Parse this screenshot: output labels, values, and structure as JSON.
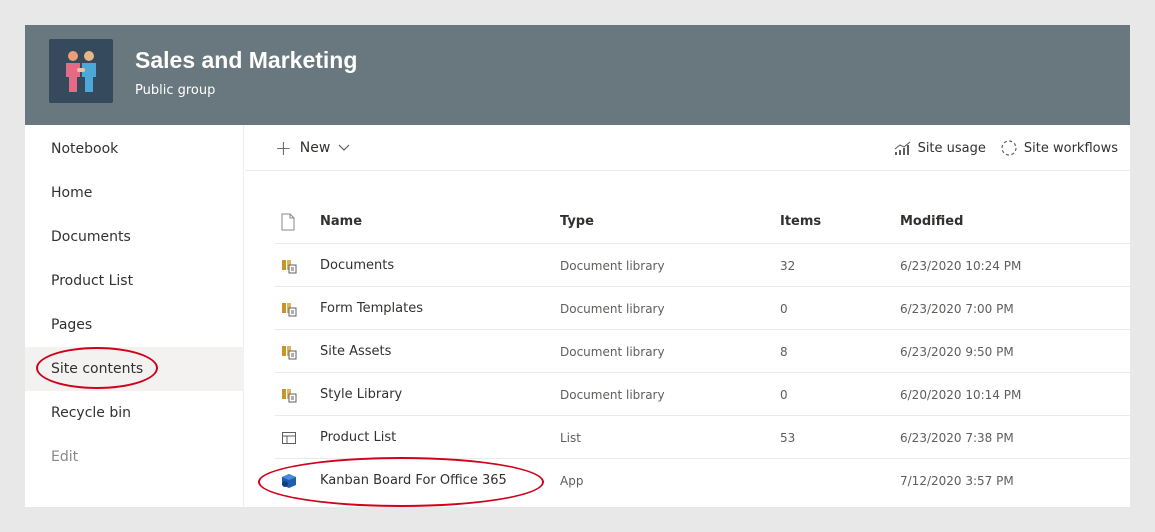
{
  "header": {
    "title": "Sales and Marketing",
    "subtitle": "Public group"
  },
  "leftnav": {
    "items": [
      {
        "label": "Notebook"
      },
      {
        "label": "Home"
      },
      {
        "label": "Documents"
      },
      {
        "label": "Product List"
      },
      {
        "label": "Pages"
      },
      {
        "label": "Site contents"
      },
      {
        "label": "Recycle bin"
      },
      {
        "label": "Edit"
      }
    ]
  },
  "commandbar": {
    "new_label": "New",
    "site_usage": "Site usage",
    "site_workflows": "Site workflows"
  },
  "table": {
    "columns": [
      "Name",
      "Type",
      "Items",
      "Modified"
    ],
    "rows": [
      {
        "icon": "document-library-icon",
        "name": "Documents",
        "type": "Document library",
        "items": "32",
        "modified": "6/23/2020 10:24 PM"
      },
      {
        "icon": "document-library-icon",
        "name": "Form Templates",
        "type": "Document library",
        "items": "0",
        "modified": "6/23/2020 7:00 PM"
      },
      {
        "icon": "document-library-icon",
        "name": "Site Assets",
        "type": "Document library",
        "items": "8",
        "modified": "6/23/2020 9:50 PM"
      },
      {
        "icon": "document-library-icon",
        "name": "Style Library",
        "type": "Document library",
        "items": "0",
        "modified": "6/20/2020 10:14 PM"
      },
      {
        "icon": "list-icon",
        "name": "Product List",
        "type": "List",
        "items": "53",
        "modified": "6/23/2020 7:38 PM"
      },
      {
        "icon": "app-icon",
        "name": "Kanban Board For Office 365",
        "type": "App",
        "items": "",
        "modified": "7/12/2020 3:57 PM"
      }
    ]
  },
  "colors": {
    "header_bg": "#69787e",
    "logo_bg": "#354a5c",
    "annotation": "#d0021b",
    "library_icon": "#c8952c",
    "app_icon": "#1f5fad"
  }
}
